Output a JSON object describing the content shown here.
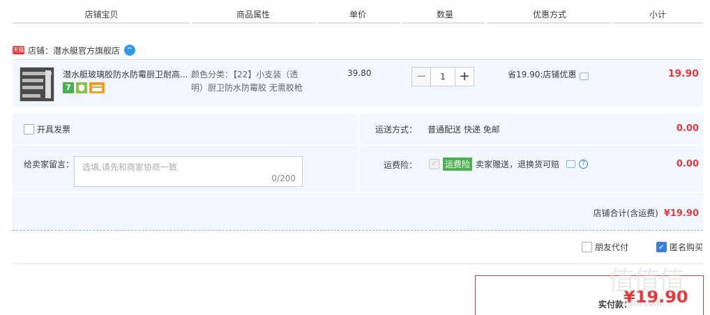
{
  "columns": [
    "店铺宝贝",
    "商品属性",
    "单价",
    "数量",
    "优惠方式",
    "小计"
  ],
  "shop": {
    "tag": "天猫",
    "name": "店铺：潜水艇官方旗舰店"
  },
  "item": {
    "title": "潜水艇玻璃胶防水防霉厨卫耐高...",
    "attrs": "颜色分类：【22】小支装（透明）厨卫防水防霉胶 无需胶枪",
    "price": "39.80",
    "qty_minus": "−",
    "qty": "1",
    "qty_plus": "+",
    "promo": "省19.90:店铺优惠",
    "subtotal": "19.90",
    "badge7": "7"
  },
  "options": {
    "invoice": "开具发票",
    "message_label": "给卖家留言：",
    "message_placeholder": "选填,请先和商家协商一致",
    "message_count": "0/200",
    "shipping_label": "运送方式：",
    "shipping_value": "普通配送 快递 免邮",
    "shipping_amount": "0.00",
    "insurance_label": "运费险：",
    "insurance_tag": "运费险",
    "insurance_text": "卖家赠送，退换货可赔",
    "insurance_amount": "0.00",
    "help": "?",
    "total_label": "店铺合计(含运费)",
    "total_value": "¥19.90"
  },
  "extras": {
    "friend_pay": "朋友代付",
    "anonymous": "匿名购买"
  },
  "pay": {
    "label": "实付款：",
    "value": "¥19.90"
  },
  "watermark": {
    "big": "值值值",
    "small": "smzdm.com"
  },
  "colors": {
    "accent": "#e4393c",
    "rowbg": "#f2f7ff",
    "blue": "#3d7fd7"
  }
}
